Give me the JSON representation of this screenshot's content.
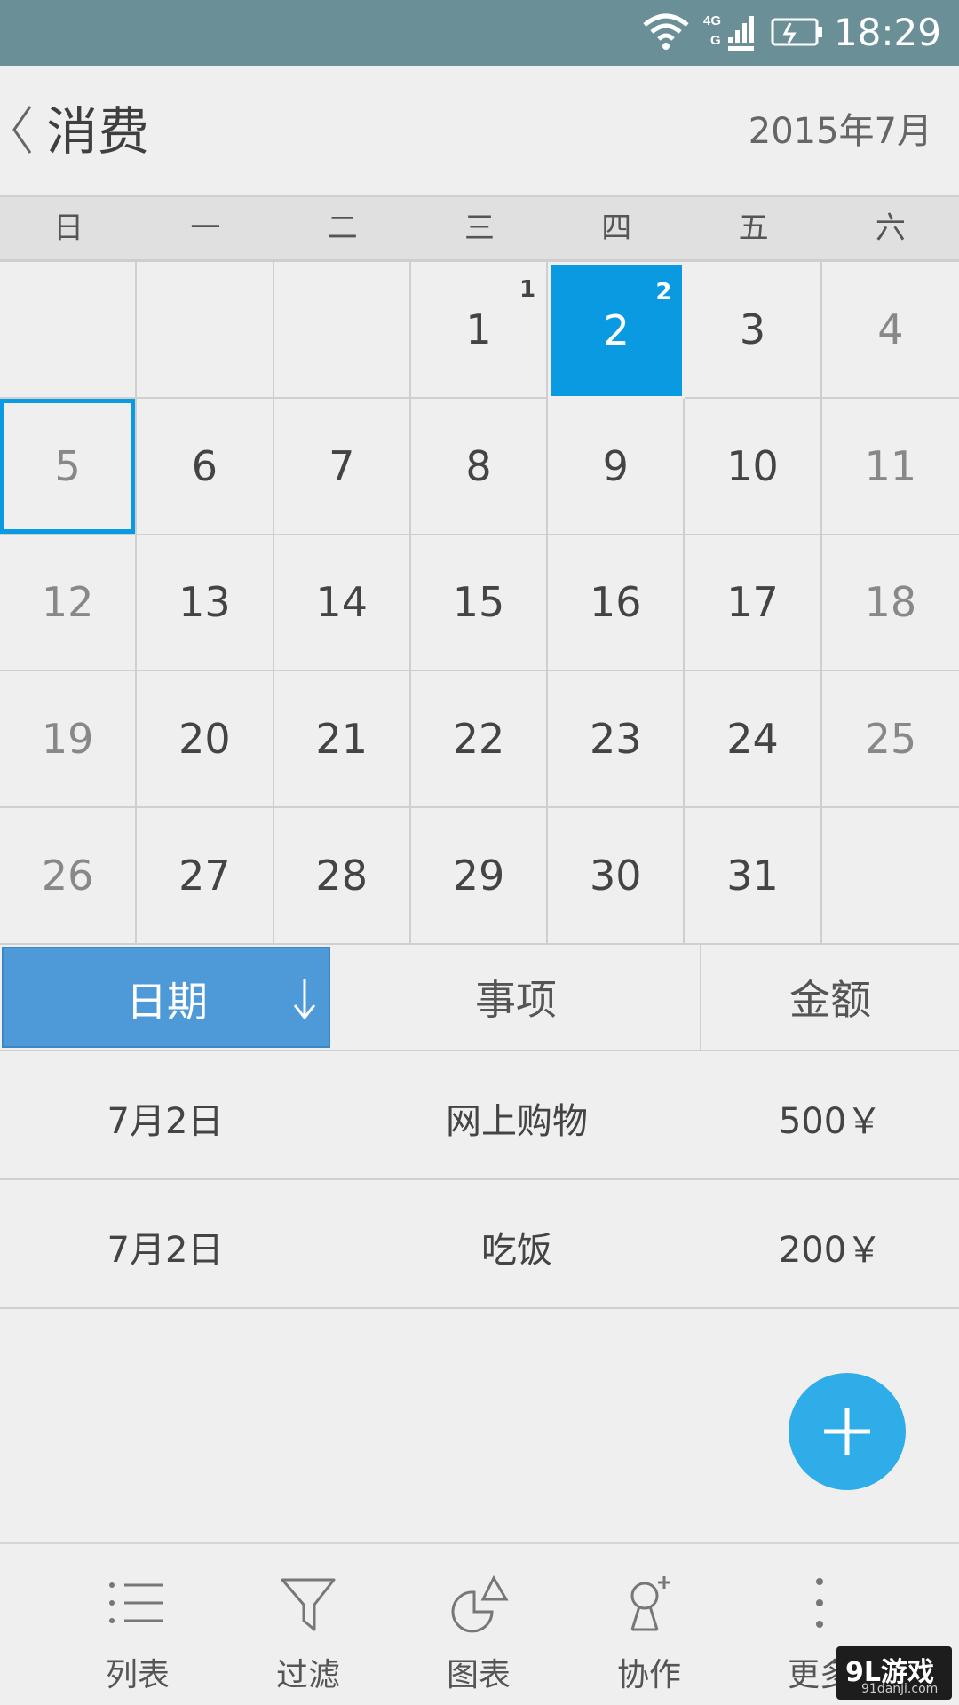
{
  "status_bar": {
    "time": "18:29",
    "network": "4G",
    "network_sub": "G"
  },
  "header": {
    "title": "消费",
    "month": "2015年7月"
  },
  "weekdays": [
    "日",
    "一",
    "二",
    "三",
    "四",
    "五",
    "六"
  ],
  "calendar": {
    "days": [
      "",
      "",
      "",
      "1",
      "2",
      "3",
      "4",
      "5",
      "6",
      "7",
      "8",
      "9",
      "10",
      "11",
      "12",
      "13",
      "14",
      "15",
      "16",
      "17",
      "18",
      "19",
      "20",
      "21",
      "22",
      "23",
      "24",
      "25",
      "26",
      "27",
      "28",
      "29",
      "30",
      "31",
      ""
    ],
    "counts": {
      "1": "1",
      "2": "2"
    },
    "selected_day": "2",
    "today": "5"
  },
  "table": {
    "columns": {
      "date": "日期",
      "item": "事项",
      "amount": "金额"
    },
    "rows": [
      {
        "date": "7月2日",
        "item": "网上购物",
        "amount": "500￥"
      },
      {
        "date": "7月2日",
        "item": "吃饭",
        "amount": "200￥"
      }
    ]
  },
  "bottom_nav": [
    {
      "label": "列表",
      "icon": "list-icon"
    },
    {
      "label": "过滤",
      "icon": "filter-icon"
    },
    {
      "label": "图表",
      "icon": "chart-icon"
    },
    {
      "label": "协作",
      "icon": "collaborate-icon"
    },
    {
      "label": "更多",
      "icon": "more-icon"
    }
  ],
  "watermark": {
    "main": "9L游戏",
    "sub": "91danji.com"
  },
  "colors": {
    "accent": "#0a9ae2",
    "header_sort": "#4e9ad8",
    "fab": "#2fade8",
    "status_bar": "#6b8f97"
  }
}
